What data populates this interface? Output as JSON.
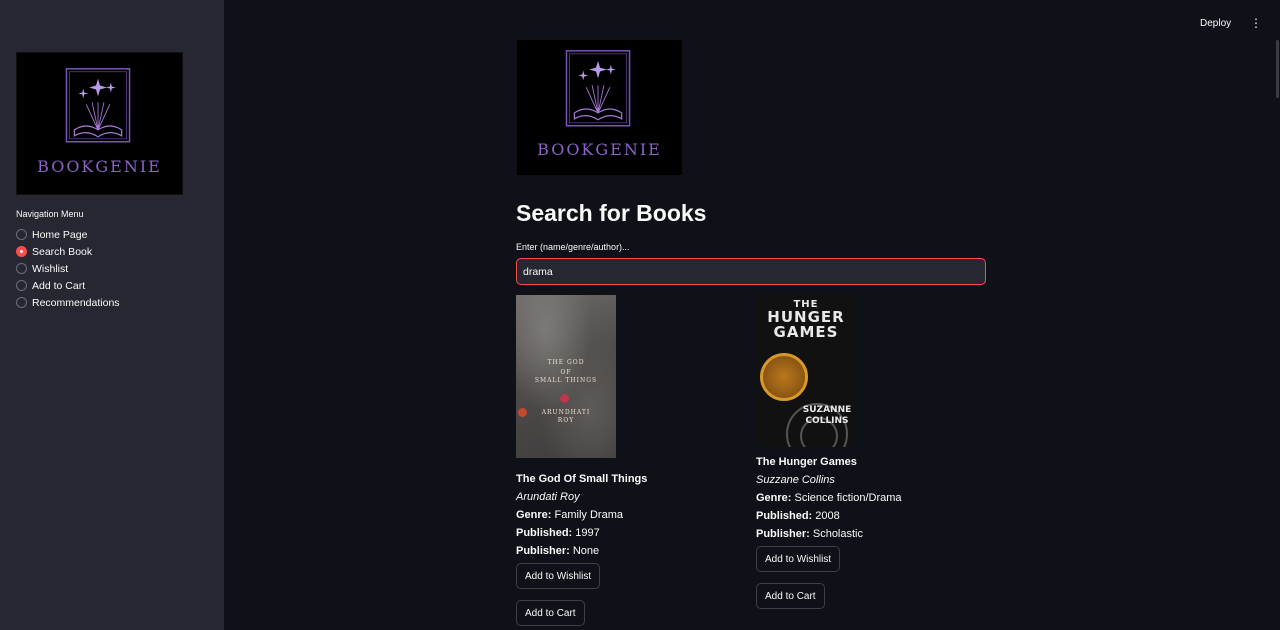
{
  "header": {
    "deploy_label": "Deploy",
    "menu_icon": "more-vertical-icon"
  },
  "sidebar": {
    "logo_text": "BOOKGENIE",
    "nav_title": "Navigation Menu",
    "items": [
      {
        "label": "Home Page",
        "selected": false
      },
      {
        "label": "Search Book",
        "selected": true
      },
      {
        "label": "Wishlist",
        "selected": false
      },
      {
        "label": "Add to Cart",
        "selected": false
      },
      {
        "label": "Recommendations",
        "selected": false
      }
    ]
  },
  "main": {
    "logo_text": "BOOKGENIE",
    "title": "Search for Books",
    "search_label": "Enter (name/genre/author)...",
    "search_value": "drama",
    "genre_label": "Genre:",
    "published_label": "Published:",
    "publisher_label": "Publisher:",
    "books": [
      {
        "title": "The God Of Small Things",
        "author": "Arundati Roy",
        "genre": "Family Drama",
        "published": "1997",
        "publisher": "None",
        "wishlist_label": "Add to Wishlist",
        "cart_label": "Add to Cart",
        "cover_text": [
          "THE GOD",
          "OF",
          "SMALL THINGS",
          "ARUNDHATI",
          "ROY"
        ]
      },
      {
        "title": "The Hunger Games",
        "author": "Suzzane Collins",
        "genre": "Science fiction/Drama",
        "published": "2008",
        "publisher": "Scholastic",
        "wishlist_label": "Add to Wishlist",
        "cart_label": "Add to Cart",
        "cover_text": [
          "THE",
          "HUNGER",
          "GAMES",
          "SUZANNE",
          "COLLINS"
        ]
      }
    ]
  },
  "colors": {
    "accent": "#ff4b4b",
    "brand": "#8c63c9",
    "background": "#0e1117",
    "sidebar": "#262730"
  }
}
